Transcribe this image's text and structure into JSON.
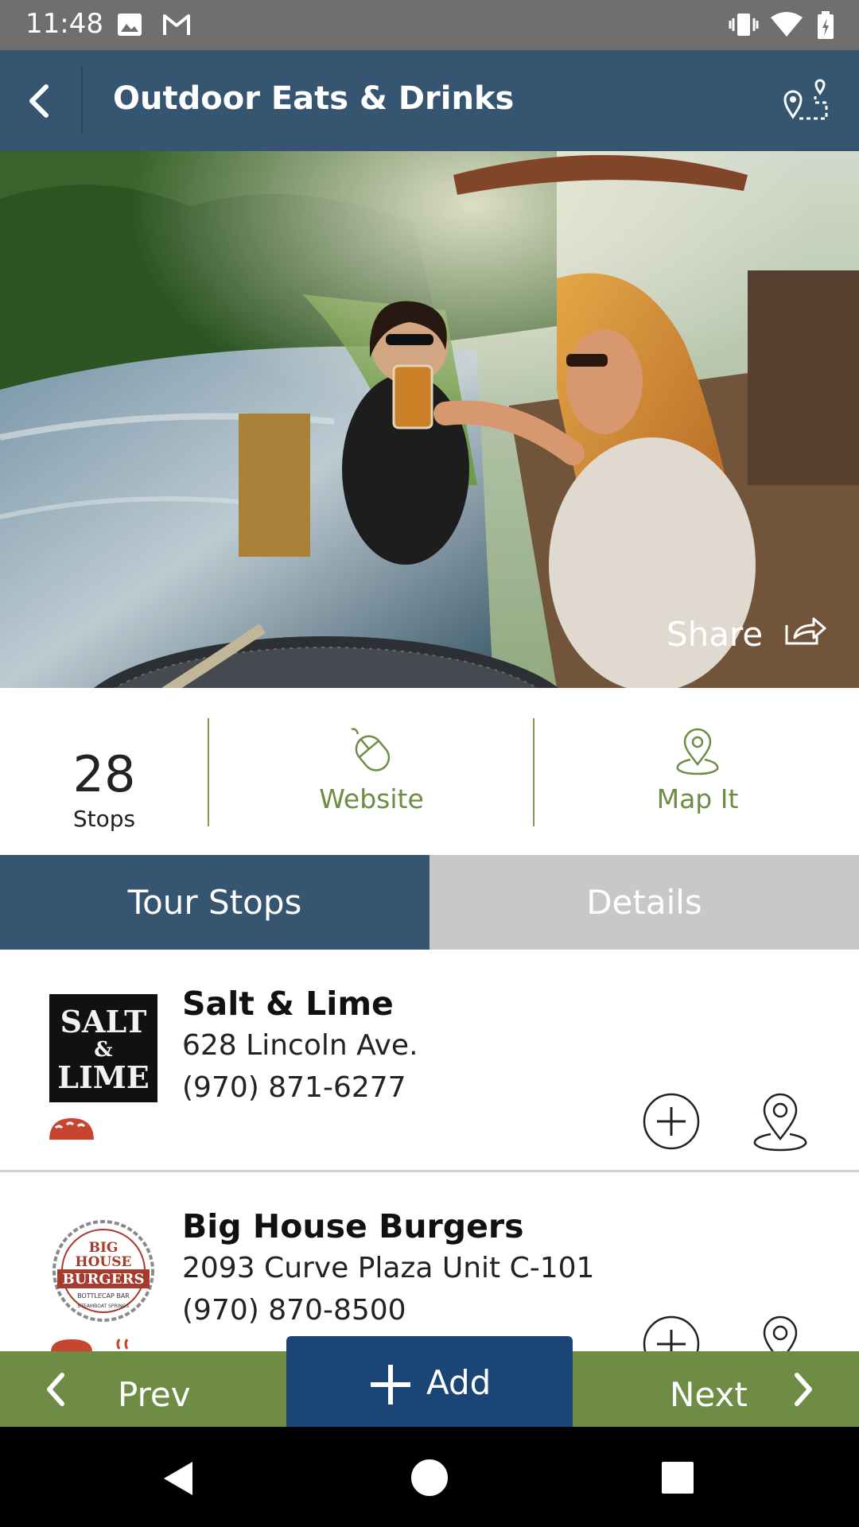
{
  "status_bar": {
    "time": "11:48",
    "left_icons": [
      "image-icon",
      "gmail-icon"
    ],
    "right_icons": [
      "vibrate-icon",
      "wifi-icon",
      "battery-icon"
    ]
  },
  "header": {
    "title": "Outdoor Eats & Drinks",
    "back_icon": "chevron-left-icon",
    "route_icon": "map-route-icon"
  },
  "hero": {
    "share_label": "Share",
    "share_icon": "share-icon"
  },
  "stats": {
    "stops_count": "28",
    "stops_label": "Stops",
    "website_label": "Website",
    "website_icon": "mouse-icon",
    "map_label": "Map It",
    "map_icon": "map-pin-icon"
  },
  "tabs": [
    {
      "label": "Tour Stops",
      "active": true
    },
    {
      "label": "Details",
      "active": false
    }
  ],
  "stops": [
    {
      "name": "Salt & Lime",
      "address": "628 Lincoln Ave.",
      "phone": "(970) 871-6277",
      "logo_text": [
        "SALT",
        "&",
        "LIME"
      ],
      "category_icons": [
        "taco-icon"
      ]
    },
    {
      "name": "Big House Burgers",
      "address": "2093 Curve Plaza Unit C-101",
      "phone": "(970) 870-8500",
      "logo_text": [
        "BIG",
        "HOUSE",
        "BURGERS",
        "BOTTLECAP BAR",
        "STEAMBOAT SPRINGS"
      ],
      "category_icons": [
        "burger-icon",
        "grill-icon"
      ]
    }
  ],
  "bottom_nav": {
    "prev_label": "Prev",
    "add_label": "Add",
    "next_label": "Next"
  },
  "colors": {
    "header_bg": "#355570",
    "accent_green": "#6f8c45",
    "add_button": "#1b4577",
    "tab_inactive": "#c8c8c8",
    "category_red": "#c7442f"
  }
}
